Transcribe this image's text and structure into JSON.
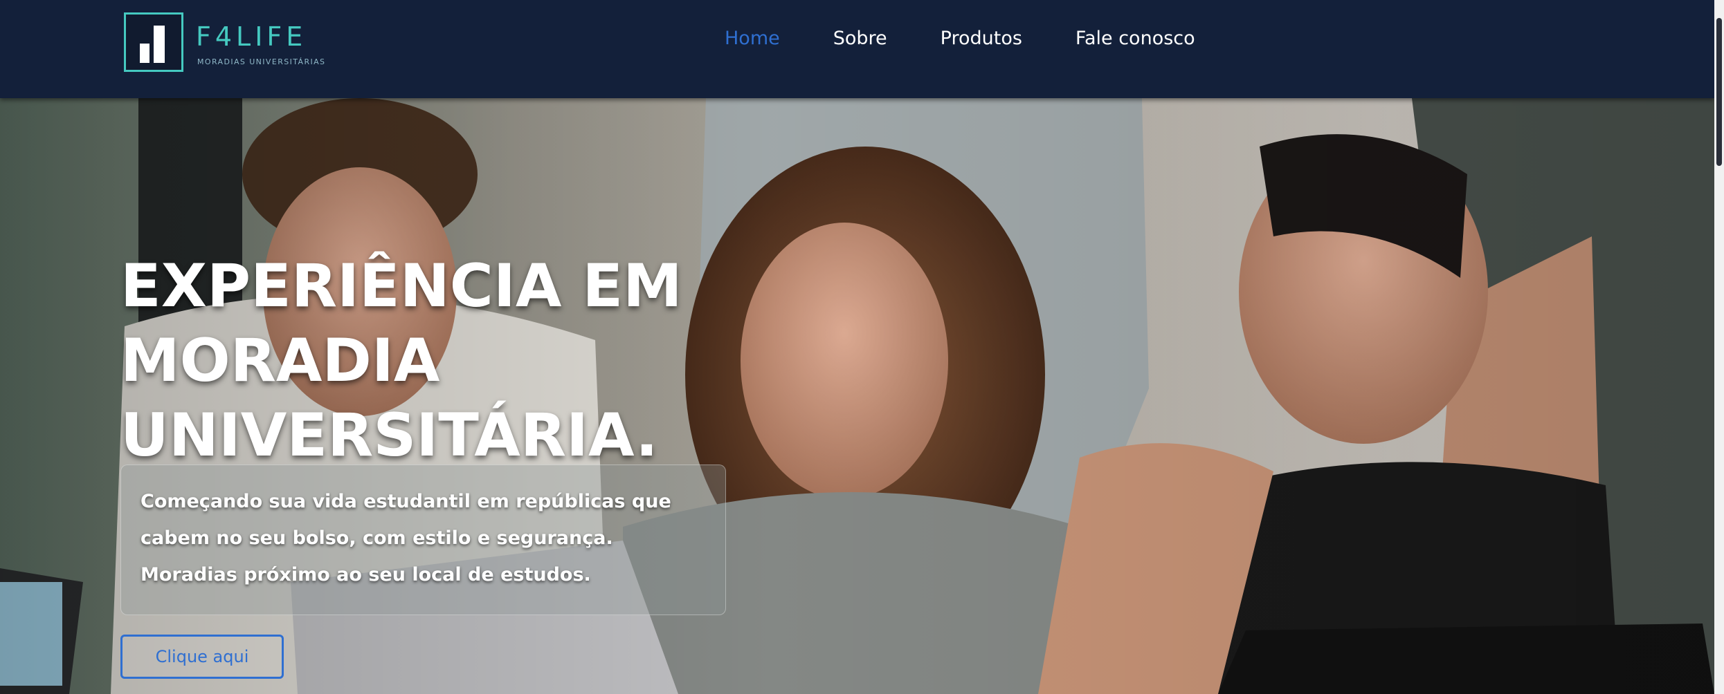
{
  "brand": {
    "name": "F4LIFE",
    "tagline": "MORADIAS UNIVERSITÁRIAS",
    "accent_color": "#45c9c0",
    "logo_icon": "bar-chart-icon"
  },
  "nav": {
    "items": [
      {
        "label": "Home",
        "active": true
      },
      {
        "label": "Sobre",
        "active": false
      },
      {
        "label": "Produtos",
        "active": false
      },
      {
        "label": "Fale conosco",
        "active": false
      }
    ],
    "active_color": "#2f6fd1",
    "background": "#13203a"
  },
  "hero": {
    "headline_lines": [
      "EXPERIÊNCIA EM",
      "MORADIA",
      "UNIVERSITÁRIA."
    ],
    "subtitle_lines": [
      "Começando sua vida estudantil em repúblicas que",
      "cabem no seu bolso, com estilo e segurança.",
      "Moradias próximo ao seu local de estudos."
    ],
    "cta_label": "Clique aqui",
    "cta_color": "#2f6fd1"
  }
}
